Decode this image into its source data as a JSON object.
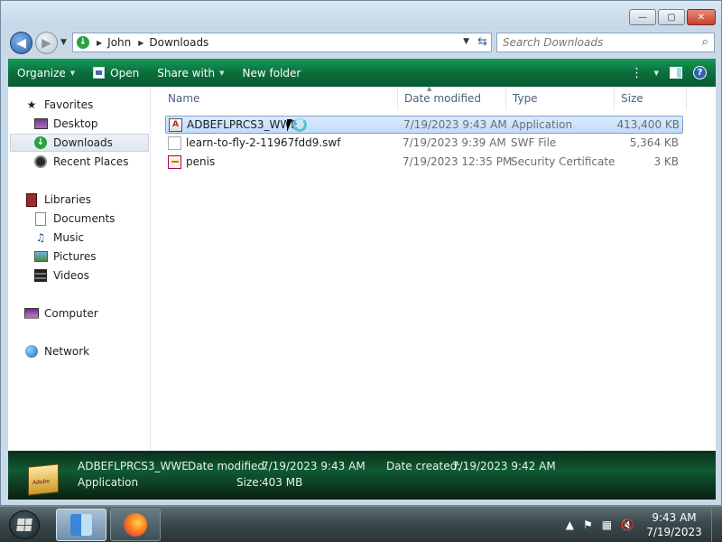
{
  "window": {
    "controls": {
      "minimize": "—",
      "maximize": "▢",
      "close": "✕"
    }
  },
  "address": {
    "breadcrumbs": [
      "John",
      "Downloads"
    ]
  },
  "search": {
    "placeholder": "Search Downloads"
  },
  "toolbar": {
    "organize": "Organize",
    "open": "Open",
    "share_with": "Share with",
    "new_folder": "New folder"
  },
  "navpane": {
    "favorites": "Favorites",
    "desktop": "Desktop",
    "downloads": "Downloads",
    "recent_places": "Recent Places",
    "libraries": "Libraries",
    "documents": "Documents",
    "music": "Music",
    "pictures": "Pictures",
    "videos": "Videos",
    "computer": "Computer",
    "network": "Network"
  },
  "columns": {
    "name": "Name",
    "date_modified": "Date modified",
    "type": "Type",
    "size": "Size"
  },
  "files": [
    {
      "name": "ADBEFLPRCS3_WWE",
      "date": "7/19/2023 9:43 AM",
      "type": "Application",
      "size": "413,400 KB",
      "icon": "application-icon",
      "selected": true
    },
    {
      "name": "learn-to-fly-2-11967fdd9.swf",
      "date": "7/19/2023 9:39 AM",
      "type": "SWF File",
      "size": "5,364 KB",
      "icon": "swf-file-icon",
      "selected": false
    },
    {
      "name": "penis",
      "date": "7/19/2023 12:35 PM",
      "type": "Security Certificate",
      "size": "3 KB",
      "icon": "certificate-icon",
      "selected": false
    }
  ],
  "details": {
    "name": "ADBEFLPRCS3_WWE",
    "type": "Application",
    "date_modified_label": "Date modified:",
    "date_modified": "7/19/2023 9:43 AM",
    "date_created_label": "Date created:",
    "date_created": "7/19/2023 9:42 AM",
    "size_label": "Size:",
    "size": "403 MB"
  },
  "taskbar": {
    "time": "9:43 AM",
    "date": "7/19/2023"
  },
  "colors": {
    "toolbar": "#0b6f3c",
    "selection": "#c1dcfb",
    "accent": "#2d63a7"
  }
}
